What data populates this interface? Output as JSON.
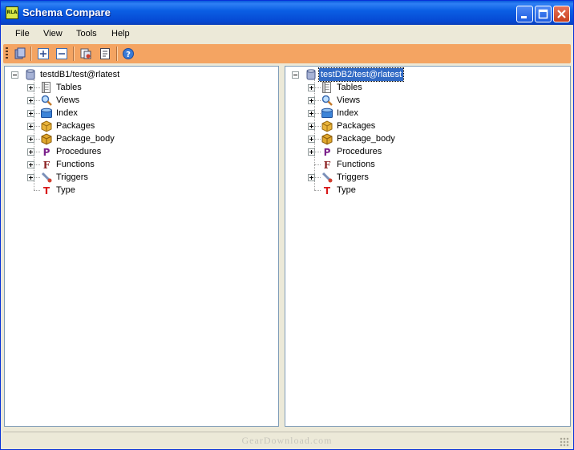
{
  "window": {
    "title": "Schema Compare",
    "app_icon_text": "RLA"
  },
  "menu": [
    "File",
    "View",
    "Tools",
    "Help"
  ],
  "toolbar": {
    "tools": [
      "database-icon",
      "expand-all-icon",
      "collapse-all-icon",
      "compare-icon",
      "report-icon",
      "help-icon"
    ]
  },
  "left_tree": {
    "root": "testdB1/test@rlatest",
    "items": [
      {
        "label": "Tables",
        "icon": "table-icon",
        "expandable": true
      },
      {
        "label": "Views",
        "icon": "view-icon",
        "expandable": true
      },
      {
        "label": "Index",
        "icon": "index-icon",
        "expandable": true
      },
      {
        "label": "Packages",
        "icon": "package-icon",
        "expandable": true
      },
      {
        "label": "Package_body",
        "icon": "package-body-icon",
        "expandable": true
      },
      {
        "label": "Procedures",
        "icon": "procedure-icon",
        "expandable": true
      },
      {
        "label": "Functions",
        "icon": "function-icon",
        "expandable": true
      },
      {
        "label": "Triggers",
        "icon": "trigger-icon",
        "expandable": true
      },
      {
        "label": "Type",
        "icon": "type-icon",
        "expandable": false
      }
    ]
  },
  "right_tree": {
    "root": "testDB2/test@rlatest",
    "items": [
      {
        "label": "Tables",
        "icon": "table-icon",
        "expandable": true
      },
      {
        "label": "Views",
        "icon": "view-icon",
        "expandable": true
      },
      {
        "label": "Index",
        "icon": "index-icon",
        "expandable": true
      },
      {
        "label": "Packages",
        "icon": "package-icon",
        "expandable": true
      },
      {
        "label": "Package_body",
        "icon": "package-body-icon",
        "expandable": true
      },
      {
        "label": "Procedures",
        "icon": "procedure-icon",
        "expandable": true
      },
      {
        "label": "Functions",
        "icon": "function-icon",
        "expandable": false
      },
      {
        "label": "Triggers",
        "icon": "trigger-icon",
        "expandable": true
      },
      {
        "label": "Type",
        "icon": "type-icon",
        "expandable": false
      }
    ]
  },
  "status": {
    "watermark": "GearDownload.com"
  },
  "colors": {
    "toolbar": "#f4a462",
    "titlebar": "#0b5fe4",
    "selection": "#316ac5"
  }
}
